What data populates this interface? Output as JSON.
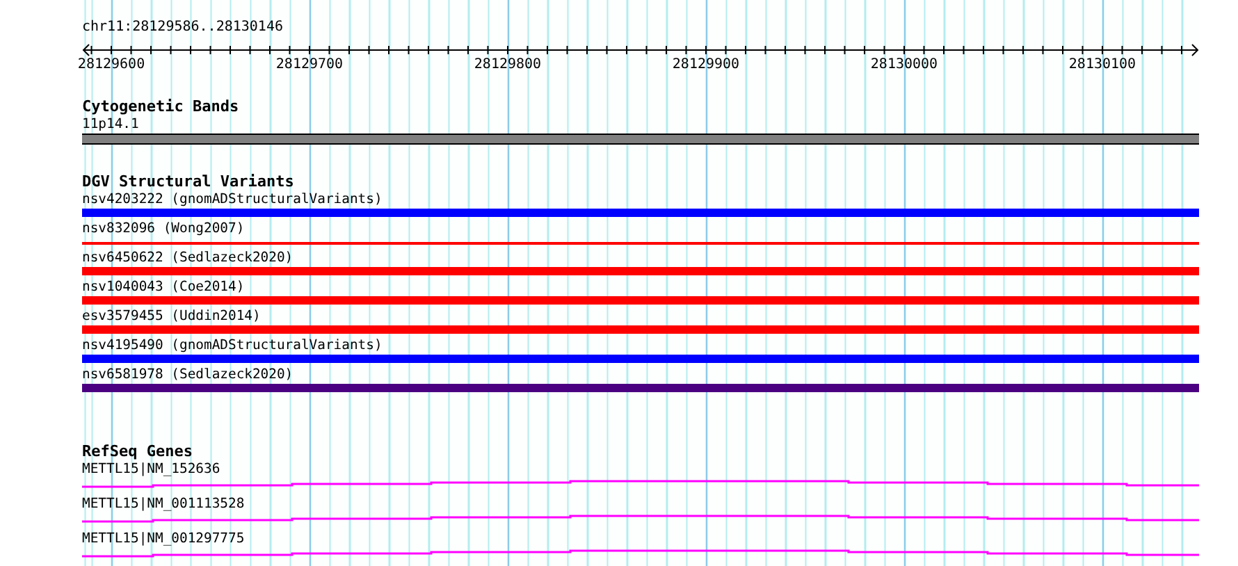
{
  "location": "chr11:28129586..28130146",
  "ruler": {
    "labels": [
      "28129600",
      "28129700",
      "28129800",
      "28129900",
      "28130000",
      "28130100"
    ]
  },
  "cytogenetic_bands": {
    "title": "Cytogenetic Bands",
    "bands": [
      {
        "label": "11p14.1",
        "color": "#808080"
      }
    ]
  },
  "structural_variants": {
    "title": "DGV Structural Variants",
    "items": [
      {
        "label": "nsv4203222 (gnomADStructuralVariants)",
        "color": "#0000ff",
        "kind": "thick"
      },
      {
        "label": "nsv832096 (Wong2007)",
        "color": "#ff0000",
        "kind": "thin"
      },
      {
        "label": "nsv6450622 (Sedlazeck2020)",
        "color": "#ff0000",
        "kind": "thick"
      },
      {
        "label": "nsv1040043 (Coe2014)",
        "color": "#ff0000",
        "kind": "thick"
      },
      {
        "label": "esv3579455 (Uddin2014)",
        "color": "#ff0000",
        "kind": "thick"
      },
      {
        "label": "nsv4195490 (gnomADStructuralVariants)",
        "color": "#0000ff",
        "kind": "thick"
      },
      {
        "label": "nsv6581978 (Sedlazeck2020)",
        "color": "#4b0082",
        "kind": "thick"
      }
    ]
  },
  "refseq_genes": {
    "title": "RefSeq Genes",
    "items": [
      {
        "label": "METTL15|NM_152636"
      },
      {
        "label": "METTL15|NM_001113528"
      },
      {
        "label": "METTL15|NM_001297775"
      }
    ]
  }
}
